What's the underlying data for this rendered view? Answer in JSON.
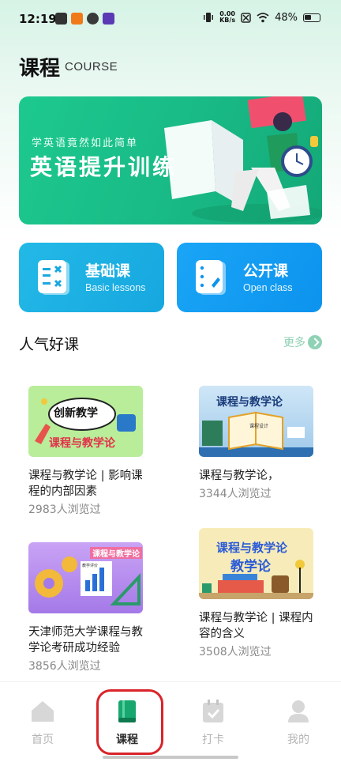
{
  "status_bar": {
    "time": "12:19",
    "net_speed_value": "0.00",
    "net_speed_unit": "KB/s",
    "battery": "48%"
  },
  "header": {
    "title": "课程",
    "subtitle": "COURSE"
  },
  "banner": {
    "subtitle": "学英语竟然如此简单",
    "title": "英语提升训练"
  },
  "categories": [
    {
      "title": "基础课",
      "subtitle": "Basic lessons",
      "icon": "list-calc-icon"
    },
    {
      "title": "公开课",
      "subtitle": "Open class",
      "icon": "notebook-icon"
    }
  ],
  "section": {
    "title": "人气好课",
    "more": "更多"
  },
  "courses": [
    {
      "title": "课程与教学论 | 影响课程的内部因素",
      "views": "2983人浏览过",
      "thumb_text_1": "创新教学",
      "thumb_text_2": "课程与教学论"
    },
    {
      "title": "课程与教学论，",
      "views": "3344人浏览过",
      "thumb_text_1": "课程与教学论",
      "thumb_text_2": "课程设计"
    },
    {
      "title": "天津师范大学课程与教学论考研成功经验",
      "views": "3856人浏览过",
      "thumb_text_1": "课程与教学论",
      "thumb_text_2": "教学评价"
    },
    {
      "title": "课程与教学论 | 课程内容的含义",
      "views": "3508人浏览过",
      "thumb_text_1": "课程与教学论",
      "thumb_text_2": "教学论"
    }
  ],
  "nav": [
    {
      "label": "首页",
      "icon": "home-icon",
      "active": false
    },
    {
      "label": "课程",
      "icon": "book-icon",
      "active": true
    },
    {
      "label": "打卡",
      "icon": "calendar-check-icon",
      "active": false
    },
    {
      "label": "我的",
      "icon": "user-icon",
      "active": false
    }
  ],
  "colors": {
    "accent_green": "#1dc98f",
    "active_nav": "#18a86f",
    "highlight_ring": "#d8242a",
    "blue_card": "#16a7df"
  }
}
